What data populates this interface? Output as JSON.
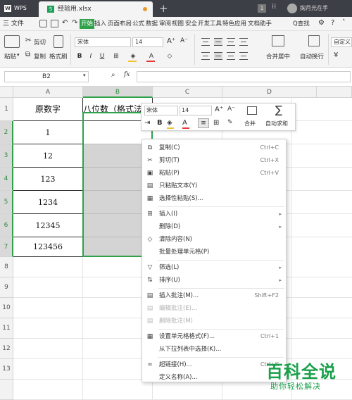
{
  "titlebar": {
    "app": "WPS",
    "tab_title": "经验用.xlsx",
    "new_tab": "+",
    "badge": "1",
    "user": "掬月光在手"
  },
  "menubar": {
    "file": "三 文件",
    "tabs": [
      "开始",
      "插入",
      "页面布局",
      "公式",
      "数据",
      "审阅",
      "视图",
      "安全",
      "开发工具",
      "特色应用",
      "文档助手"
    ],
    "search": "Q查找"
  },
  "ribbon": {
    "paste": "粘贴",
    "cut": "剪切",
    "copy": "复制",
    "format_painter": "格式刷",
    "font_name": "宋体",
    "font_size": "14",
    "bold": "B",
    "italic": "I",
    "underline": "U",
    "merge": "合并居中",
    "wrap": "自动换行",
    "right_box": "自定义"
  },
  "formula_bar": {
    "name_box": "B2",
    "fx": "fx",
    "value": ""
  },
  "grid": {
    "columns": [
      "A",
      "B",
      "C",
      "D"
    ],
    "rows": [
      "1",
      "2",
      "3",
      "4",
      "5",
      "6",
      "7",
      "8",
      "9",
      "10",
      "11",
      "12",
      "13"
    ],
    "A_header": "原数字",
    "B_header": "八位数（格式法",
    "A_values": [
      "1",
      "12",
      "123",
      "1234",
      "12345",
      "123456"
    ]
  },
  "mini_toolbar": {
    "font_name": "宋体",
    "font_size": "14",
    "grow": "A⁺",
    "shrink": "A⁻",
    "merge": "合并",
    "autosum": "自动求和"
  },
  "context_menu": {
    "copy": {
      "label": "复制(C)",
      "shortcut": "Ctrl+C"
    },
    "cut": {
      "label": "剪切(T)",
      "shortcut": "Ctrl+X"
    },
    "paste": {
      "label": "粘贴(P)",
      "shortcut": "Ctrl+V"
    },
    "paste_text": {
      "label": "只粘贴文本(Y)"
    },
    "paste_special": {
      "label": "选择性粘贴(S)..."
    },
    "insert": {
      "label": "插入(I)"
    },
    "delete": {
      "label": "删除(D)"
    },
    "clear": {
      "label": "清除内容(N)"
    },
    "batch": {
      "label": "批量处理单元格(P)"
    },
    "filter": {
      "label": "筛选(L)"
    },
    "sort": {
      "label": "排序(U)"
    },
    "insert_comment": {
      "label": "插入批注(M)...",
      "shortcut": "Shift+F2"
    },
    "edit_comment": {
      "label": "编辑批注(E)..."
    },
    "delete_comment": {
      "label": "删除批注(M)"
    },
    "format_cells": {
      "label": "设置单元格格式(F)...",
      "shortcut": "Ctrl+1"
    },
    "pick_list": {
      "label": "从下拉列表中选择(K)..."
    },
    "hyperlink": {
      "label": "超链接(H)...",
      "shortcut": "Ctrl+K"
    },
    "define_name": {
      "label": "定义名称(A)..."
    }
  },
  "watermark": {
    "title": "百科全说",
    "subtitle": "助你轻松解决"
  }
}
